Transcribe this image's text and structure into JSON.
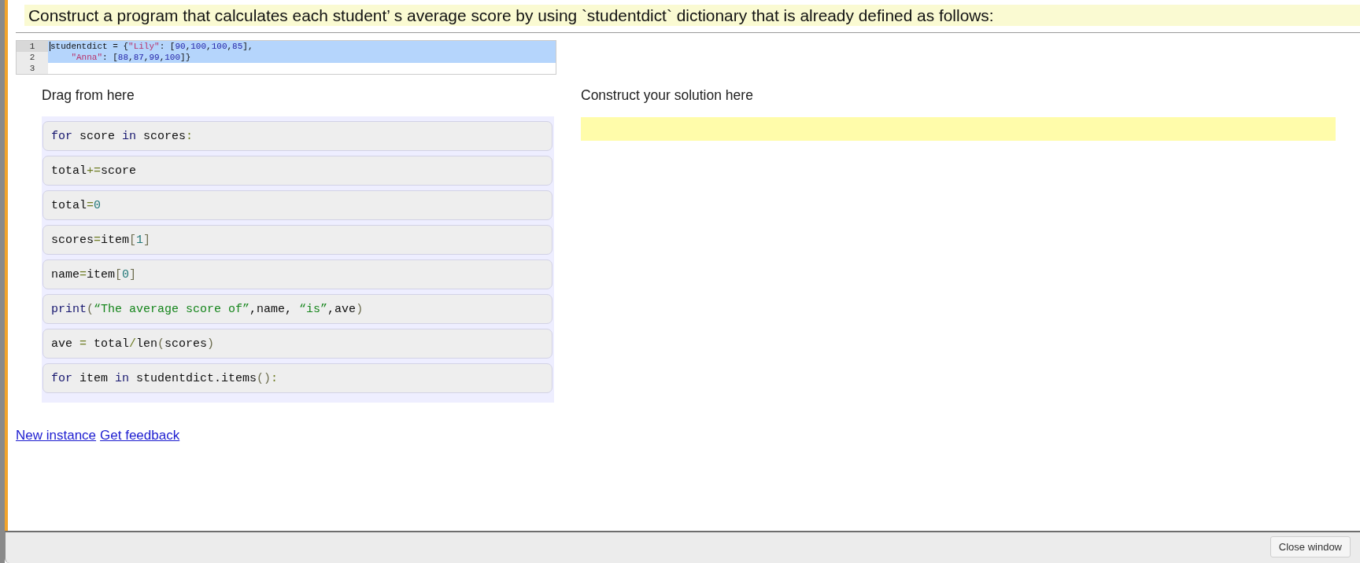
{
  "prompt": {
    "text": "Construct a program that calculates each student’ s average score by using `studentdict` dictionary that is already defined as follows:"
  },
  "editor": {
    "lines": [
      {
        "number": "1",
        "selected": true,
        "cursor": true,
        "tokens": [
          {
            "text": "studentdict = {",
            "kind": "plain"
          },
          {
            "text": "\"Lily\"",
            "kind": "string"
          },
          {
            "text": ": [",
            "kind": "plain"
          },
          {
            "text": "90",
            "kind": "number"
          },
          {
            "text": ",",
            "kind": "plain"
          },
          {
            "text": "100",
            "kind": "number"
          },
          {
            "text": ",",
            "kind": "plain"
          },
          {
            "text": "100",
            "kind": "number"
          },
          {
            "text": ",",
            "kind": "plain"
          },
          {
            "text": "85",
            "kind": "number"
          },
          {
            "text": "],",
            "kind": "plain"
          }
        ]
      },
      {
        "number": "2",
        "selected": true,
        "cursor": false,
        "tokens": [
          {
            "text": "    \"Anna\"",
            "kind": "string"
          },
          {
            "text": ": [",
            "kind": "plain"
          },
          {
            "text": "88",
            "kind": "number"
          },
          {
            "text": ",",
            "kind": "plain"
          },
          {
            "text": "87",
            "kind": "number"
          },
          {
            "text": ",",
            "kind": "plain"
          },
          {
            "text": "99",
            "kind": "number"
          },
          {
            "text": ",",
            "kind": "plain"
          },
          {
            "text": "100",
            "kind": "number"
          },
          {
            "text": "]}",
            "kind": "plain"
          }
        ]
      },
      {
        "number": "3",
        "selected": false,
        "cursor": false
      }
    ]
  },
  "source": {
    "title": "Drag from here",
    "blocks": [
      {
        "tokens": [
          {
            "text": "for",
            "kind": "keyword"
          },
          {
            "text": " score ",
            "kind": "name"
          },
          {
            "text": "in",
            "kind": "keyword"
          },
          {
            "text": " scores",
            "kind": "name"
          },
          {
            "text": ":",
            "kind": "op"
          }
        ]
      },
      {
        "tokens": [
          {
            "text": "total",
            "kind": "name"
          },
          {
            "text": "+=",
            "kind": "op"
          },
          {
            "text": "score",
            "kind": "name"
          }
        ]
      },
      {
        "tokens": [
          {
            "text": "total",
            "kind": "name"
          },
          {
            "text": "=",
            "kind": "op"
          },
          {
            "text": "0",
            "kind": "number"
          }
        ]
      },
      {
        "tokens": [
          {
            "text": "scores",
            "kind": "name"
          },
          {
            "text": "=",
            "kind": "op"
          },
          {
            "text": "item",
            "kind": "name"
          },
          {
            "text": "[",
            "kind": "punct"
          },
          {
            "text": "1",
            "kind": "number"
          },
          {
            "text": "]",
            "kind": "punct"
          }
        ]
      },
      {
        "tokens": [
          {
            "text": "name",
            "kind": "name"
          },
          {
            "text": "=",
            "kind": "op"
          },
          {
            "text": "item",
            "kind": "name"
          },
          {
            "text": "[",
            "kind": "punct"
          },
          {
            "text": "0",
            "kind": "number"
          },
          {
            "text": "]",
            "kind": "punct"
          }
        ]
      },
      {
        "tokens": [
          {
            "text": "print",
            "kind": "keyword"
          },
          {
            "text": "(",
            "kind": "punct"
          },
          {
            "text": "“The average score of”",
            "kind": "string"
          },
          {
            "text": ",name, ",
            "kind": "name"
          },
          {
            "text": "“is”",
            "kind": "string"
          },
          {
            "text": ",ave",
            "kind": "name"
          },
          {
            "text": ")",
            "kind": "punct"
          }
        ]
      },
      {
        "tokens": [
          {
            "text": "ave ",
            "kind": "name"
          },
          {
            "text": "=",
            "kind": "op"
          },
          {
            "text": " total",
            "kind": "name"
          },
          {
            "text": "/",
            "kind": "op"
          },
          {
            "text": "len",
            "kind": "name"
          },
          {
            "text": "(",
            "kind": "punct"
          },
          {
            "text": "scores",
            "kind": "name"
          },
          {
            "text": ")",
            "kind": "punct"
          }
        ]
      },
      {
        "tokens": [
          {
            "text": "for",
            "kind": "keyword"
          },
          {
            "text": " item ",
            "kind": "name"
          },
          {
            "text": "in",
            "kind": "keyword"
          },
          {
            "text": " studentdict.items",
            "kind": "name"
          },
          {
            "text": "()",
            "kind": "punct"
          },
          {
            "text": ":",
            "kind": "op"
          }
        ]
      }
    ]
  },
  "solution": {
    "title": "Construct your solution here"
  },
  "links": [
    "New instance",
    "Get feedback"
  ],
  "footer": {
    "button": "Close window"
  }
}
